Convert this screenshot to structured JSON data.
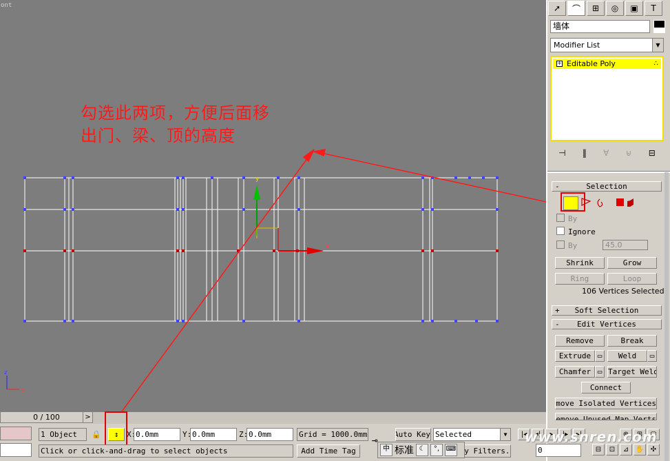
{
  "viewport": {
    "label": "ont",
    "annotation_line1": "勾选此两项，方便后面移",
    "annotation_line2": "出门、梁、顶的高度",
    "gizmo_x": "x",
    "gizmo_y": "y",
    "axis_x": "x",
    "axis_z": "z"
  },
  "panel": {
    "tabs": [
      "create-icon",
      "modify-icon",
      "hierarchy-icon",
      "motion-icon",
      "display-icon",
      "utilities-icon"
    ],
    "object_name": "墙体",
    "modifier_list": "Modifier List",
    "stack_item": "Editable Poly",
    "selection": {
      "title": "Selection",
      "by_vertex": "By",
      "ignore_backfacing": "Ignore",
      "by_angle": "By",
      "angle_value": "45.0",
      "shrink": "Shrink",
      "grow": "Grow",
      "ring": "Ring",
      "loop": "Loop",
      "info": "106 Vertices Selected"
    },
    "soft_selection": {
      "title": "Soft Selection"
    },
    "edit_vertices": {
      "title": "Edit Vertices",
      "remove": "Remove",
      "break": "Break",
      "extrude": "Extrude",
      "weld": "Weld",
      "chamfer": "Chamfer",
      "target_weld": "Target Weld",
      "connect": "Connect",
      "remove_isolated": "Remove Isolated Vertices",
      "remove_unused": "Remove Unused Map Verts"
    }
  },
  "status": {
    "time": "0 / 100",
    "objects": "1 Object",
    "x_label": "X:",
    "x_value": "0.0mm",
    "y_label": "Y:",
    "y_value": "0.0mm",
    "z_label": "Z:",
    "z_value": "0.0mm",
    "grid": "Grid = 1000.0mm",
    "auto_key": "Auto Key",
    "selected": "Selected",
    "prompt": "Click or click-and-drag to select objects",
    "add_time_tag": "Add Time Tag",
    "filters": "Key Filters...",
    "frame": "0",
    "ime_text": "标准"
  },
  "watermark": "www.snren.com"
}
